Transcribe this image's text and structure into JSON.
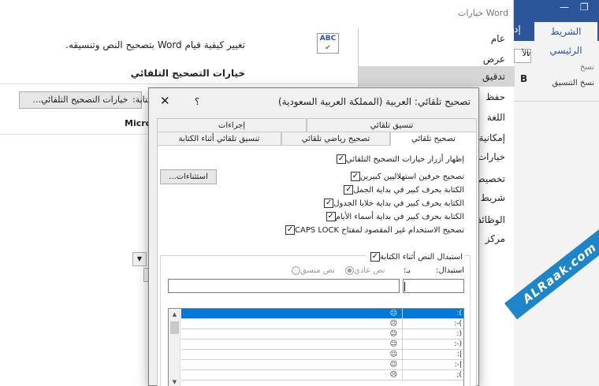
{
  "word_options": {
    "window_title": "خيارات Word",
    "close": "✕",
    "nav": [
      {
        "label": "عام",
        "active": false
      },
      {
        "label": "عرض",
        "active": false
      },
      {
        "label": "تدقيق",
        "active": true
      },
      {
        "label": "حفظ",
        "active": false
      },
      {
        "label": "اللغة",
        "active": false
      },
      {
        "label": "إمكانية",
        "active": false
      },
      {
        "label": "خيارات",
        "active": false
      },
      {
        "label": "تخصيص",
        "active": false
      },
      {
        "label": "شريط",
        "active": false
      },
      {
        "label": "الوظائف",
        "active": false
      },
      {
        "label": "مركز",
        "active": false
      }
    ],
    "icon_text": "ABC",
    "description": "تغيير كيفية قيام Word بتصحيح النص وتنسيقه.",
    "section_heading": "خيارات التصحيح التلقائي",
    "autocorrect_button": "خيارات التصحيح التلقائي...",
    "autocorrect_label": "كتابة:",
    "micro_label": "Micro",
    "dropdown_arrow": "▼"
  },
  "ribbon": {
    "min": "—",
    "restore": "❐",
    "tab": "الشريط الرئيسي",
    "edge_letter": "إد",
    "items": [
      "نسخ",
      "نسخ التنسيق"
    ],
    "bold": "B",
    "font_box": "الأ",
    "font_arrow": "v"
  },
  "dialog": {
    "title": "تصحيح تلقائي: العربية (المملكة العربية السعودية)",
    "help": "؟",
    "close": "✕",
    "tabs_row1": [
      "تنسيق تلقائي",
      "إجراءات"
    ],
    "tabs_row2": [
      "تصحيح تلقائي",
      "تصحيح رياضي تلقائي",
      "تنسيق تلقائي أثناء الكتابة"
    ],
    "show_buttons": "إظهار أزرار خيارات التصحيح التلقائي",
    "options": [
      "تصحيح حرفين استهلاليين كبيرين",
      "الكتابة بحرف كبير في بداية الجمل",
      "الكتابة بحرف كبير في بداية خلايا الجدول",
      "الكتابة بحرف كبير في بداية أسماء الأيام",
      "تصحيح الاستخدام غير المقصود لمفتاح CAPS LOCK"
    ],
    "exceptions_button": "استثناءات...",
    "replace_as_you_type": "استبدال النص أثناء الكتابة",
    "replace_label": "استبدال:",
    "with_label": "بـ:",
    "plain_text": "نص عادي",
    "formatted_text": "نص منسق",
    "scroll_up": "▲",
    "scroll_down": "▼",
    "entries": [
      {
        "replace": ":(",
        "with": "☹",
        "selected": true
      },
      {
        "replace": ":-(",
        "with": "☹",
        "selected": false
      },
      {
        "replace": ":)",
        "with": "☺",
        "selected": false
      },
      {
        "replace": ":-)",
        "with": "☺",
        "selected": false
      },
      {
        "replace": ":|",
        "with": "😐",
        "selected": false
      },
      {
        "replace": ":-|",
        "with": "😐",
        "selected": false
      },
      {
        "replace": ";(",
        "with": "☹",
        "selected": false
      }
    ]
  },
  "watermark": "ALRaak.com"
}
